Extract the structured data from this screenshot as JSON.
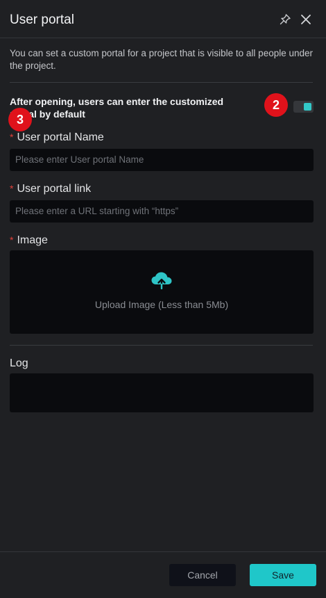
{
  "header": {
    "title": "User portal",
    "pin_icon": "pin-icon",
    "close_icon": "close-icon"
  },
  "description": "You can set a custom portal for a project that is visible to all people under the project.",
  "toggle": {
    "label": "After opening, users can enter the customized portal by default",
    "state": "on",
    "accent_color": "#32c8c8"
  },
  "badges": {
    "badge_2": "2",
    "badge_3": "3",
    "color": "#e0121b"
  },
  "fields": {
    "required_mark": "*",
    "name_label": "User portal Name",
    "name_placeholder": "Please enter User portal Name",
    "link_label": "User portal link",
    "link_placeholder": "Please enter a URL starting with “https”",
    "image_label": "Image",
    "upload_icon": "cloud-upload-icon",
    "upload_text": "Upload Image (Less than 5Mb)",
    "log_label": "Log"
  },
  "footer": {
    "cancel_label": "Cancel",
    "save_label": "Save",
    "save_color": "#1fc7c9"
  }
}
